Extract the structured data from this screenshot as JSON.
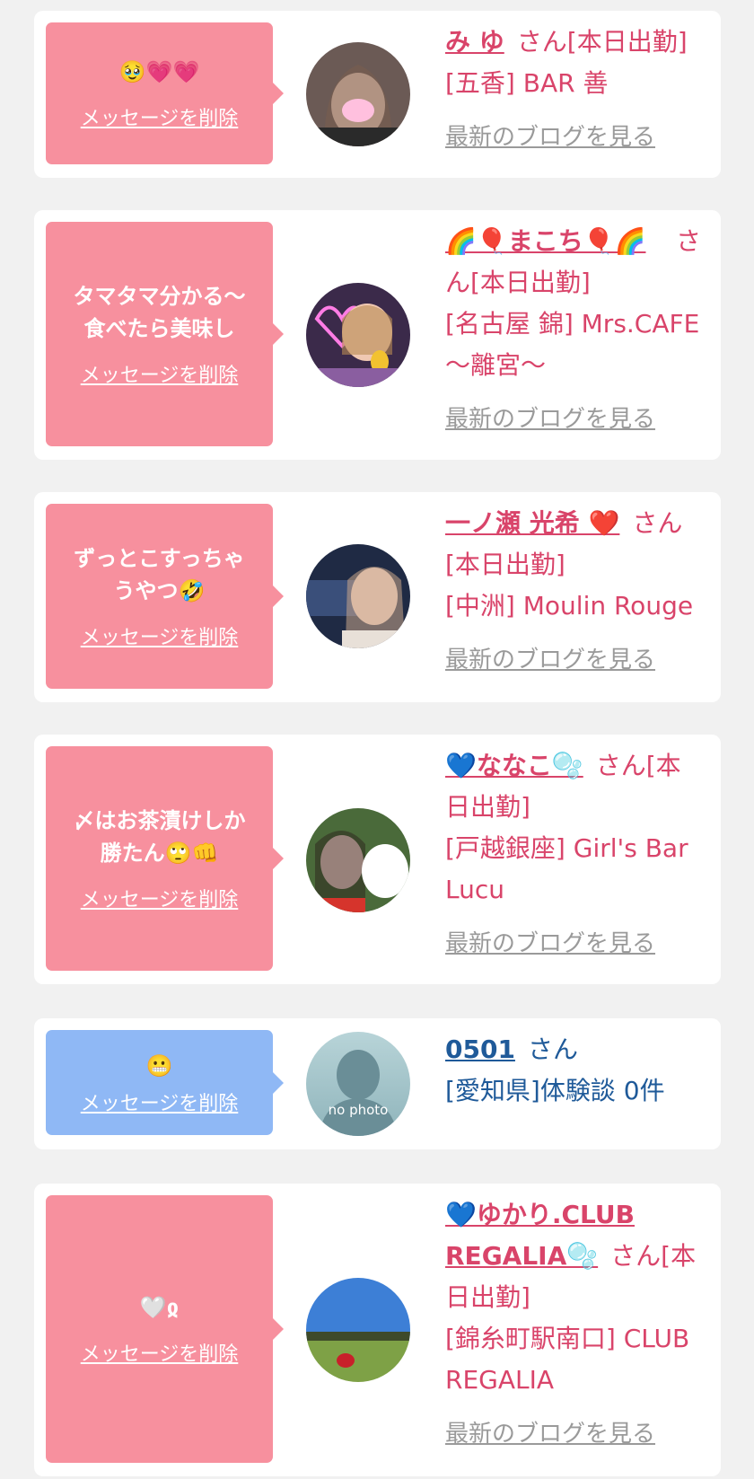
{
  "cards": [
    {
      "message": "🥹💗💗",
      "delete_label": "メッセージを削除",
      "name": "み ゆ",
      "honorific": "さん",
      "status": "[本日出勤]",
      "shop": "[五香] BAR 善",
      "blog_link": "最新のブログを見る",
      "avatar_icon": "photo-avatar"
    },
    {
      "message": "タマタマ分かる〜\n食べたら美味し",
      "delete_label": "メッセージを削除",
      "name": "🌈🎈まこち🎈🌈",
      "honorific": "さ",
      "status_line": "ん[本日出勤]",
      "shop": "[名古屋 錦] Mrs.CAFE",
      "shop_line2": "〜離宮〜",
      "blog_link": "最新のブログを見る",
      "avatar_icon": "photo-avatar"
    },
    {
      "message": "ずっとこすっちゃ\nうやつ🤣",
      "delete_label": "メッセージを削除",
      "name": "一ノ瀬 光希 ❤️",
      "honorific": "さん",
      "status": "[本日出勤]",
      "shop": "[中洲] Moulin Rouge",
      "blog_link": "最新のブログを見る",
      "avatar_icon": "photo-avatar"
    },
    {
      "message": "〆はお茶漬けしか\n勝たん🙄👊",
      "delete_label": "メッセージを削除",
      "name": "💙ななこ🫧",
      "honorific": "さん[本",
      "status_line": "日出勤]",
      "shop": "[戸越銀座] Girl's Bar",
      "shop_line2": "Lucu",
      "blog_link": "最新のブログを見る",
      "avatar_icon": "photo-avatar"
    },
    {
      "message": "😬",
      "delete_label": "メッセージを削除",
      "name": "0501",
      "honorific": "さん",
      "region": "[愛知県]体験談 0件",
      "avatar_text": "no photo",
      "avatar_icon": "person-silhouette-icon"
    },
    {
      "message": "🤍ჲ",
      "delete_label": "メッセージを削除",
      "name": "💙ゆかり.CLUB",
      "name_line2": "REGALIA🫧",
      "honorific": "さん[本",
      "status_line": "日出勤]",
      "shop": "[錦糸町駅南口] CLUB",
      "shop_line2": "REGALIA",
      "blog_link": "最新のブログを見る",
      "avatar_icon": "photo-avatar"
    }
  ],
  "colors": {
    "pink_bubble": "#f7909e",
    "blue_bubble": "#8fb8f5",
    "pink_text": "#d9446a",
    "blue_text": "#1f5a99"
  }
}
